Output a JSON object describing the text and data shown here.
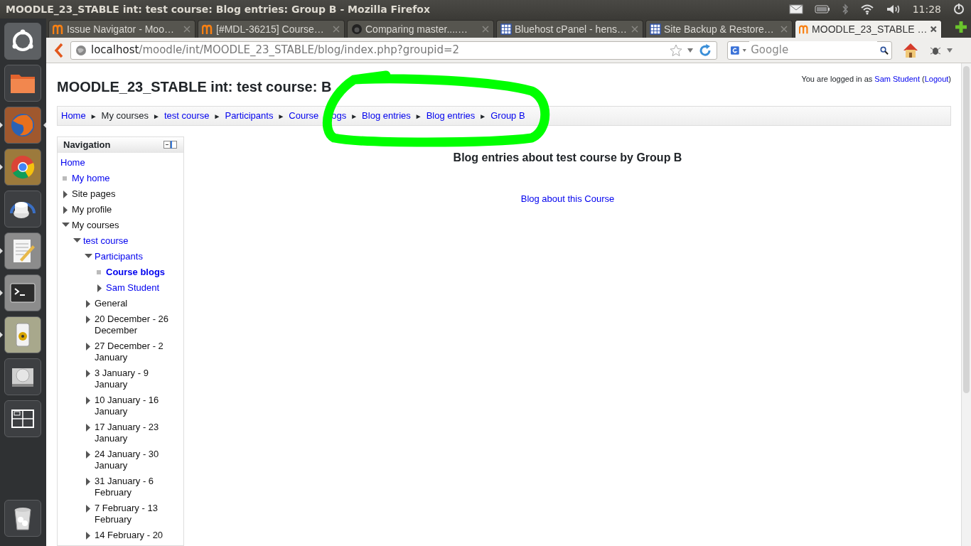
{
  "window": {
    "title": "MOODLE_23_STABLE int: test course: Blog entries: Group B - Mozilla Firefox"
  },
  "tray": {
    "clock": "11:28"
  },
  "launcher": [
    {
      "kind": "dash",
      "running": false,
      "focused": false
    },
    {
      "kind": "files",
      "running": false,
      "focused": false
    },
    {
      "kind": "firefox",
      "running": true,
      "focused": true
    },
    {
      "kind": "chrome",
      "running": true,
      "focused": false
    },
    {
      "kind": "dial",
      "running": false,
      "focused": false
    },
    {
      "kind": "editor",
      "running": true,
      "focused": false
    },
    {
      "kind": "terminal",
      "running": true,
      "focused": false
    },
    {
      "kind": "speaker",
      "running": true,
      "focused": false
    },
    {
      "kind": "disk",
      "running": false,
      "focused": false
    },
    {
      "kind": "workspaces",
      "running": false,
      "focused": false
    },
    {
      "kind": "trash",
      "running": false,
      "focused": false
    }
  ],
  "tabs": [
    {
      "title": "Issue Navigator - Moo…",
      "kind": "moodle",
      "selected": false
    },
    {
      "title": "[#MDL-36215] Course…",
      "kind": "moodle",
      "selected": false
    },
    {
      "title": "Comparing master....…",
      "kind": "github",
      "selected": false
    },
    {
      "title": "Bluehost cPanel - hens…",
      "kind": "grid",
      "selected": false
    },
    {
      "title": "Site Backup & Restore…",
      "kind": "grid",
      "selected": false
    },
    {
      "title": "MOODLE_23_STABLE …",
      "kind": "moodle",
      "selected": true
    }
  ],
  "toolbar": {
    "url": {
      "host": "localhost",
      "path": "/moodle/int/MOODLE_23_STABLE/blog/index.php?groupid=2"
    },
    "search": {
      "placeholder": "Google"
    }
  },
  "page": {
    "title": "MOODLE_23_STABLE int: test course: B",
    "login": [
      {
        "kind": "text",
        "text": "You are logged in as "
      },
      {
        "kind": "link",
        "text": "Sam Student"
      },
      {
        "kind": "text",
        "text": " ("
      },
      {
        "kind": "link",
        "text": "Logout"
      },
      {
        "kind": "text",
        "text": ")"
      }
    ],
    "breadcrumb": [
      {
        "kind": "link",
        "text": "Home"
      },
      {
        "kind": "separator",
        "text": "►"
      },
      {
        "kind": "text",
        "text": "My courses"
      },
      {
        "kind": "separator",
        "text": "►"
      },
      {
        "kind": "link",
        "text": "test course"
      },
      {
        "kind": "separator",
        "text": "►"
      },
      {
        "kind": "link",
        "text": "Participants"
      },
      {
        "kind": "separator",
        "text": "►"
      },
      {
        "kind": "link",
        "text": "Course"
      },
      {
        "kind": "link",
        "text": "ogs"
      },
      {
        "kind": "separator",
        "text": "►"
      },
      {
        "kind": "link",
        "text": "Blog entries"
      },
      {
        "kind": "separator",
        "text": "►"
      },
      {
        "kind": "link",
        "text": "Blog entries"
      },
      {
        "kind": "separator",
        "text": "►"
      },
      {
        "kind": "link",
        "text": "Group B"
      }
    ],
    "navigation": {
      "title": "Navigation",
      "items": [
        {
          "kind": "plain",
          "label": "Home",
          "link": true,
          "current": false
        },
        {
          "kind": "leaf",
          "label": "My home",
          "link": true,
          "current": false
        },
        {
          "kind": "branch",
          "label": "Site pages",
          "link": false,
          "current": false,
          "expanded": false
        },
        {
          "kind": "branch",
          "label": "My profile",
          "link": false,
          "current": false,
          "expanded": false
        },
        {
          "kind": "branch",
          "label": "My courses",
          "link": false,
          "current": false,
          "expanded": true,
          "children": [
            {
              "kind": "branch",
              "label": "test course",
              "link": true,
              "current": false,
              "expanded": true,
              "children": [
                {
                  "kind": "branch",
                  "label": "Participants",
                  "link": true,
                  "current": false,
                  "expanded": true,
                  "children": [
                    {
                      "kind": "leaf",
                      "label": "Course blogs",
                      "link": true,
                      "current": true
                    },
                    {
                      "kind": "branch",
                      "label": "Sam Student",
                      "link": true,
                      "current": false,
                      "expanded": false
                    }
                  ]
                },
                {
                  "kind": "branch",
                  "label": "General",
                  "link": false,
                  "current": false,
                  "expanded": false
                },
                {
                  "kind": "branch",
                  "label": "20 December - 26 December",
                  "link": false,
                  "current": false,
                  "expanded": false
                },
                {
                  "kind": "branch",
                  "label": "27 December - 2 January",
                  "link": false,
                  "current": false,
                  "expanded": false
                },
                {
                  "kind": "branch",
                  "label": "3 January - 9 January",
                  "link": false,
                  "current": false,
                  "expanded": false
                },
                {
                  "kind": "branch",
                  "label": "10 January - 16 January",
                  "link": false,
                  "current": false,
                  "expanded": false
                },
                {
                  "kind": "branch",
                  "label": "17 January - 23 January",
                  "link": false,
                  "current": false,
                  "expanded": false
                },
                {
                  "kind": "branch",
                  "label": "24 January - 30 January",
                  "link": false,
                  "current": false,
                  "expanded": false
                },
                {
                  "kind": "branch",
                  "label": "31 January - 6 February",
                  "link": false,
                  "current": false,
                  "expanded": false
                },
                {
                  "kind": "branch",
                  "label": "7 February - 13 February",
                  "link": false,
                  "current": false,
                  "expanded": false
                },
                {
                  "kind": "branch",
                  "label": "14 February - 20",
                  "link": false,
                  "current": false,
                  "expanded": false
                }
              ]
            }
          ]
        }
      ]
    },
    "main": {
      "heading": "Blog entries about test course by Group B",
      "link": "Blog about this Course"
    }
  }
}
